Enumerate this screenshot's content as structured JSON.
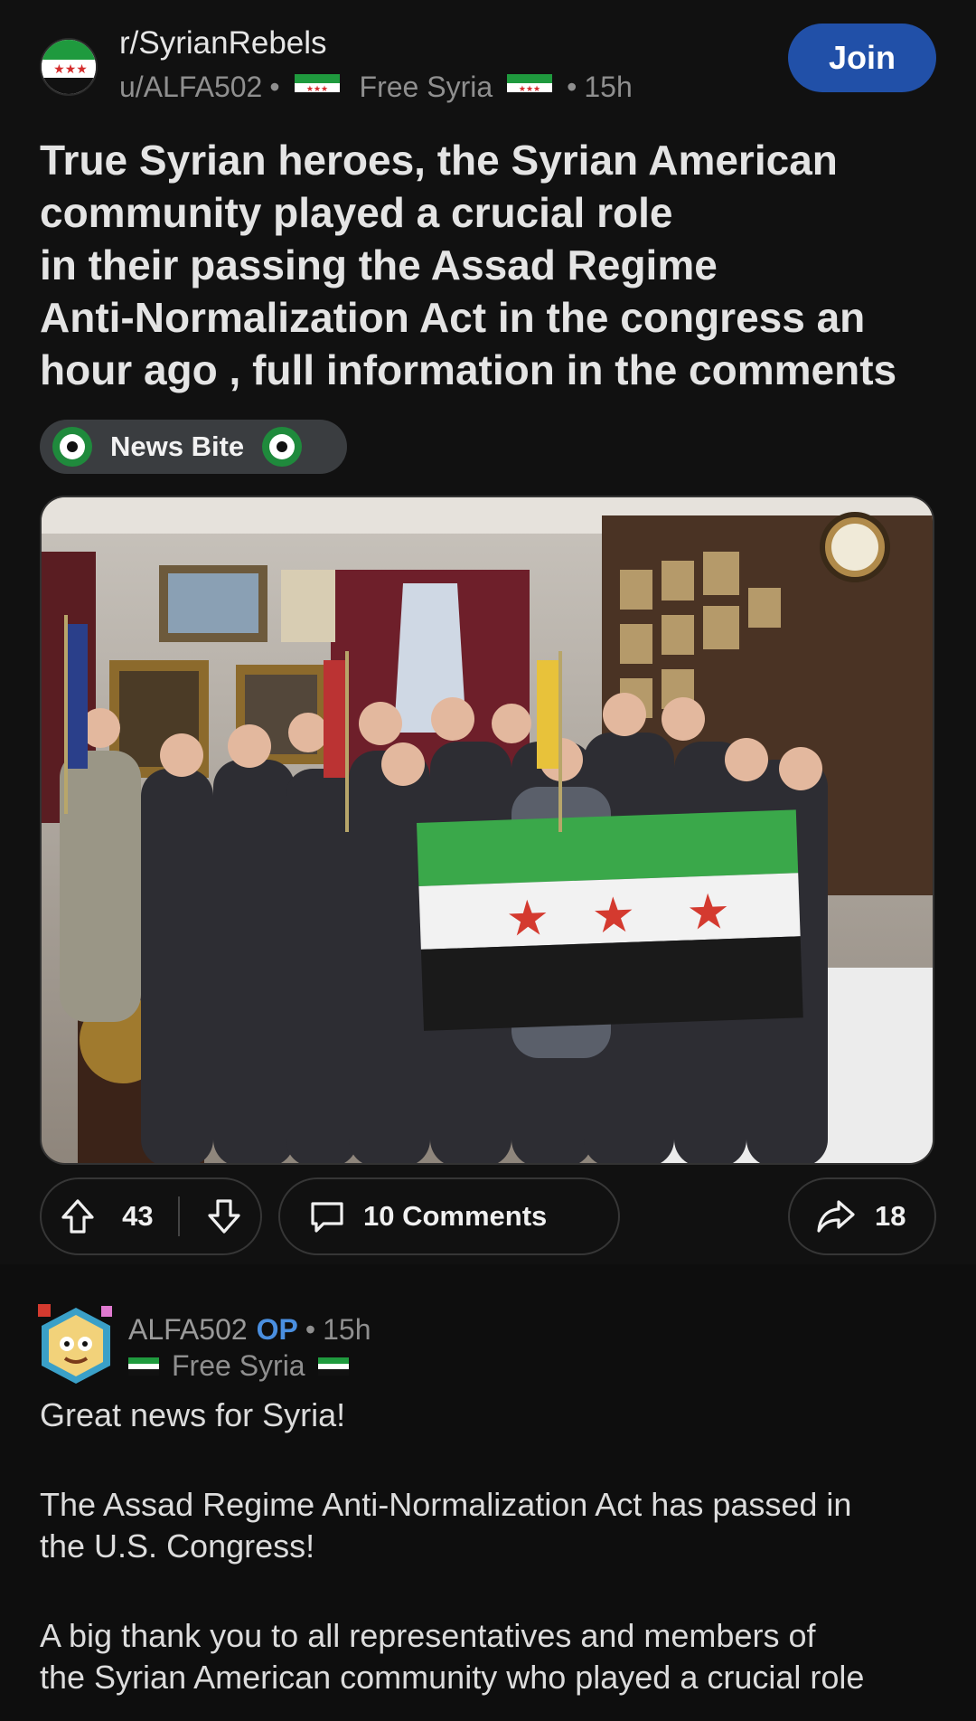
{
  "post": {
    "subreddit": "r/SyrianRebels",
    "author": "u/ALFA502",
    "author_flair": "Free Syria",
    "time": "15h",
    "join_label": "Join",
    "title_lines": [
      "True Syrian heroes, the Syrian American",
      "community played a crucial role",
      "in their passing the Assad Regime",
      "Anti-Normalization Act in the congress an",
      "hour ago , full information in the comments"
    ],
    "flair": "News Bite",
    "votes": "43",
    "comments_label": "10 Comments",
    "shares": "18"
  },
  "comment": {
    "author": "ALFA502",
    "op_badge": "OP",
    "time": "15h",
    "author_flair": "Free Syria",
    "paragraphs": [
      "Great news for Syria!",
      "The Assad Regime Anti-Normalization Act has passed in\nthe U.S. Congress!",
      "A big thank you to all representatives and members of\nthe Syrian American community who played a crucial role"
    ]
  },
  "icons": {
    "upvote": "arrow-up-icon",
    "downvote": "arrow-down-icon",
    "comment": "speech-bubble-icon",
    "share": "share-arrow-icon"
  },
  "colors": {
    "accent": "#2150a8",
    "op": "#4a8fe0",
    "flag_green": "#1f9a3e",
    "flag_red": "#d42b2b"
  }
}
